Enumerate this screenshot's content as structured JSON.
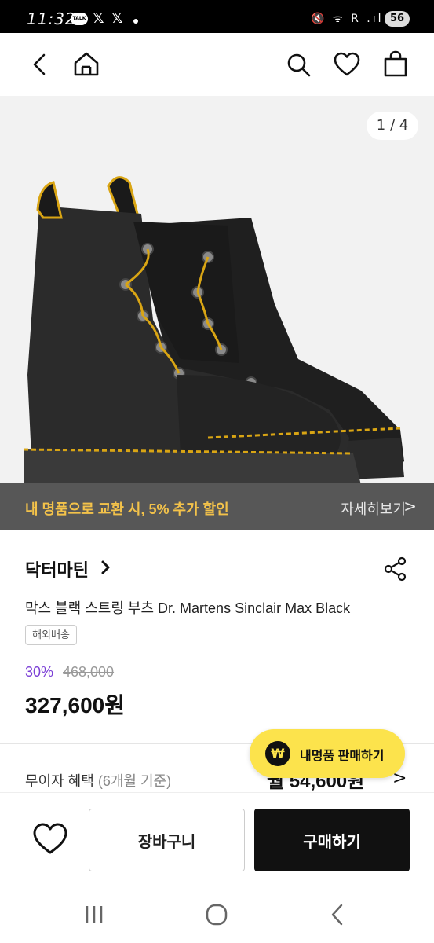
{
  "status_bar": {
    "time": "11:32",
    "talk_badge": "TALK",
    "x_icon_1": "𝕏",
    "x_icon_2": "𝕏",
    "signal_icons": "🔇 ᯤ R .ıl",
    "battery": "56"
  },
  "header": {
    "back": "back-icon",
    "home": "home-icon",
    "search": "search-icon",
    "wishlist": "heart-icon",
    "bag": "shopping-bag-icon"
  },
  "gallery": {
    "page_indicator": "1 / 4"
  },
  "promo": {
    "text": "내 명품으로 교환 시, 5% 추가 할인",
    "link": "자세히보기",
    "chevron": ">"
  },
  "product": {
    "brand": "닥터마틴",
    "name": "막스 블랙 스트링 부츠 Dr. Martens Sinclair Max Black",
    "shipping_badge": "해외배송",
    "discount": "30%",
    "original_price": "468,000",
    "price": "327,600원"
  },
  "installment": {
    "label": "무이자 혜택",
    "sub": "(6개월 기준)",
    "amount": "월 54,600원",
    "chevron": ">"
  },
  "sell_fab": {
    "icon": "₩",
    "label": "내명품 판매하기"
  },
  "actions": {
    "cart": "장바구니",
    "buy": "구매하기"
  },
  "colors": {
    "promo_text": "#f3c24a",
    "discount": "#7b3fd6",
    "fab": "#fce34c",
    "buy_button": "#111111"
  }
}
